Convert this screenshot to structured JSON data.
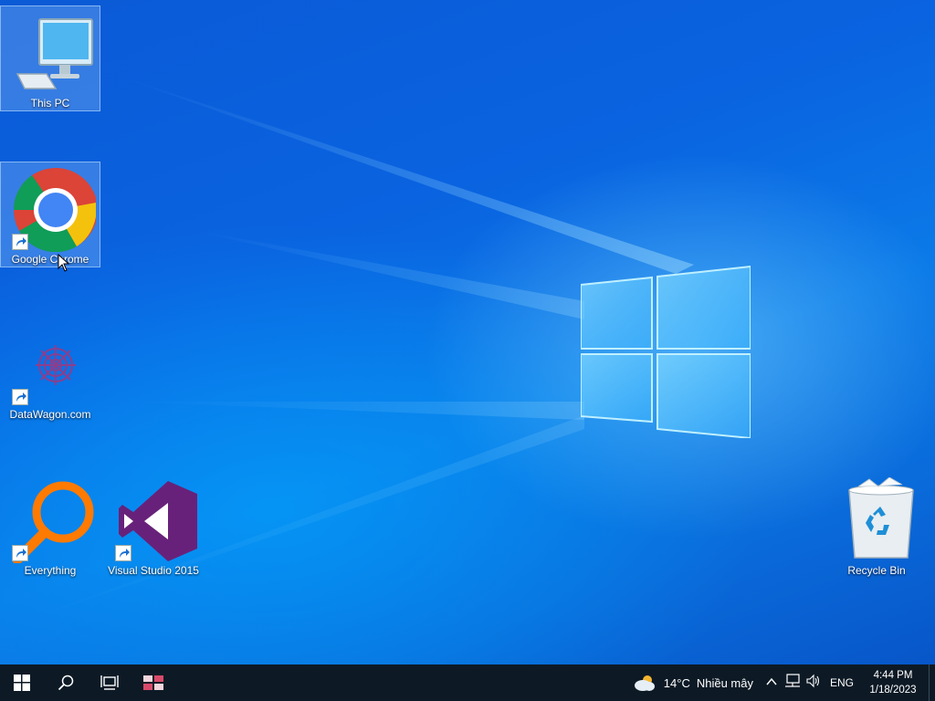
{
  "desktop": {
    "icons": [
      {
        "label": "This PC",
        "icon": "computer-icon"
      },
      {
        "label": "Google Chrome",
        "icon": "chrome-icon"
      },
      {
        "label": "DataWagon.com",
        "icon": "datawagon-icon"
      },
      {
        "label": "Everything",
        "icon": "magnifier-icon"
      },
      {
        "label": "Visual Studio 2015",
        "icon": "visual-studio-icon"
      },
      {
        "label": "Recycle Bin",
        "icon": "recycle-bin-icon"
      }
    ]
  },
  "taskbar": {
    "weather": {
      "temperature": "14°C",
      "condition": "Nhiều mây",
      "icon": "cloudy-sun-icon"
    },
    "language": "ENG",
    "time": "4:44 PM",
    "date": "1/18/2023"
  },
  "colors": {
    "taskbar": "#0d1a26",
    "wallpaper": "#0a63e0"
  }
}
